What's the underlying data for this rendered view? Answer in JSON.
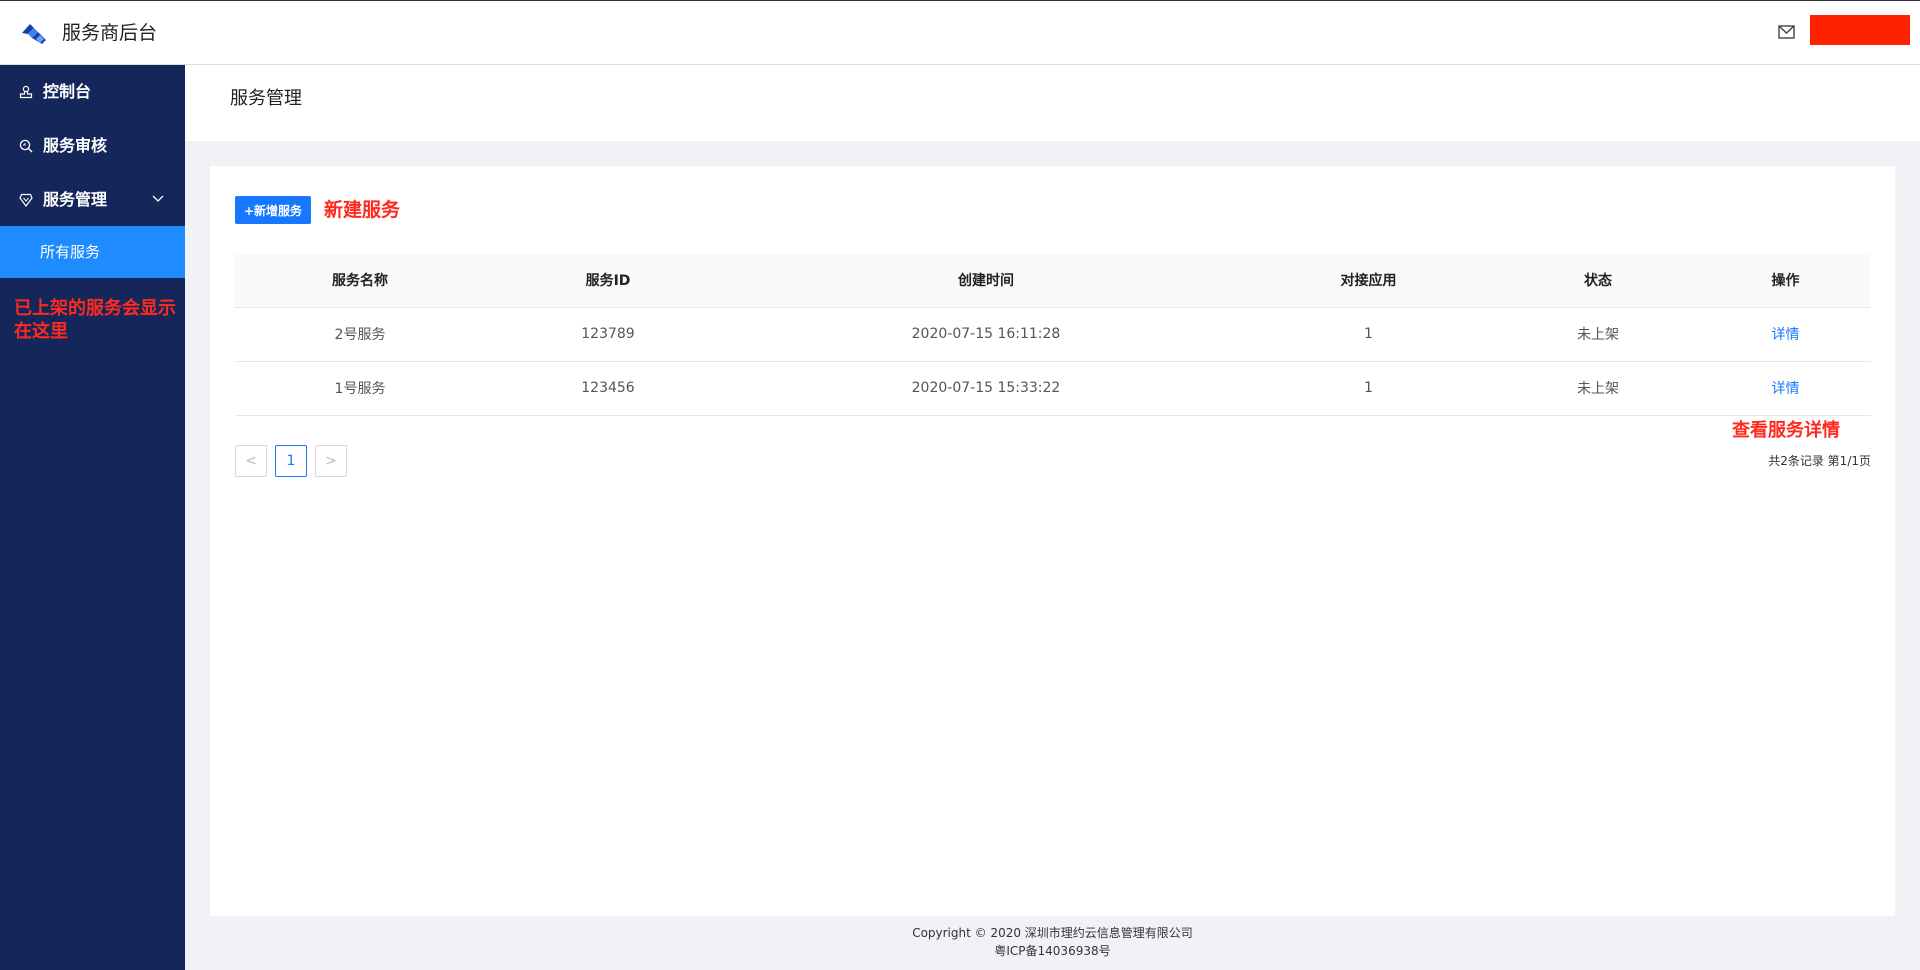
{
  "header": {
    "app_title": "服务商后台"
  },
  "sidebar": {
    "items": [
      {
        "label": "控制台"
      },
      {
        "label": "服务审核"
      },
      {
        "label": "服务管理"
      }
    ],
    "sub_item": "所有服务",
    "annotation": "已上架的服务会显示在这里"
  },
  "page": {
    "title": "服务管理"
  },
  "toolbar": {
    "add_label": "+新增服务",
    "annotation": "新建服务"
  },
  "table": {
    "columns": [
      "服务名称",
      "服务ID",
      "创建时间",
      "对接应用",
      "状态",
      "操作"
    ],
    "rows": [
      {
        "name": "2号服务",
        "id": "123789",
        "created": "2020-07-15 16:11:28",
        "apps": "1",
        "status": "未上架",
        "action": "详情"
      },
      {
        "name": "1号服务",
        "id": "123456",
        "created": "2020-07-15 15:33:22",
        "apps": "1",
        "status": "未上架",
        "action": "详情"
      }
    ],
    "detail_annotation": "查看服务详情"
  },
  "pagination": {
    "prev": "<",
    "current": "1",
    "next": ">",
    "info": "共2条记录 第1/1页"
  },
  "footer": {
    "copyright": "Copyright © 2020 深圳市理约云信息管理有限公司",
    "icp": "粤ICP备14036938号"
  },
  "colors": {
    "sidebar_bg": "#14265a",
    "active_blue": "#1e8bff",
    "primary": "#1677ff",
    "annotation_red": "#ff2a1f"
  }
}
